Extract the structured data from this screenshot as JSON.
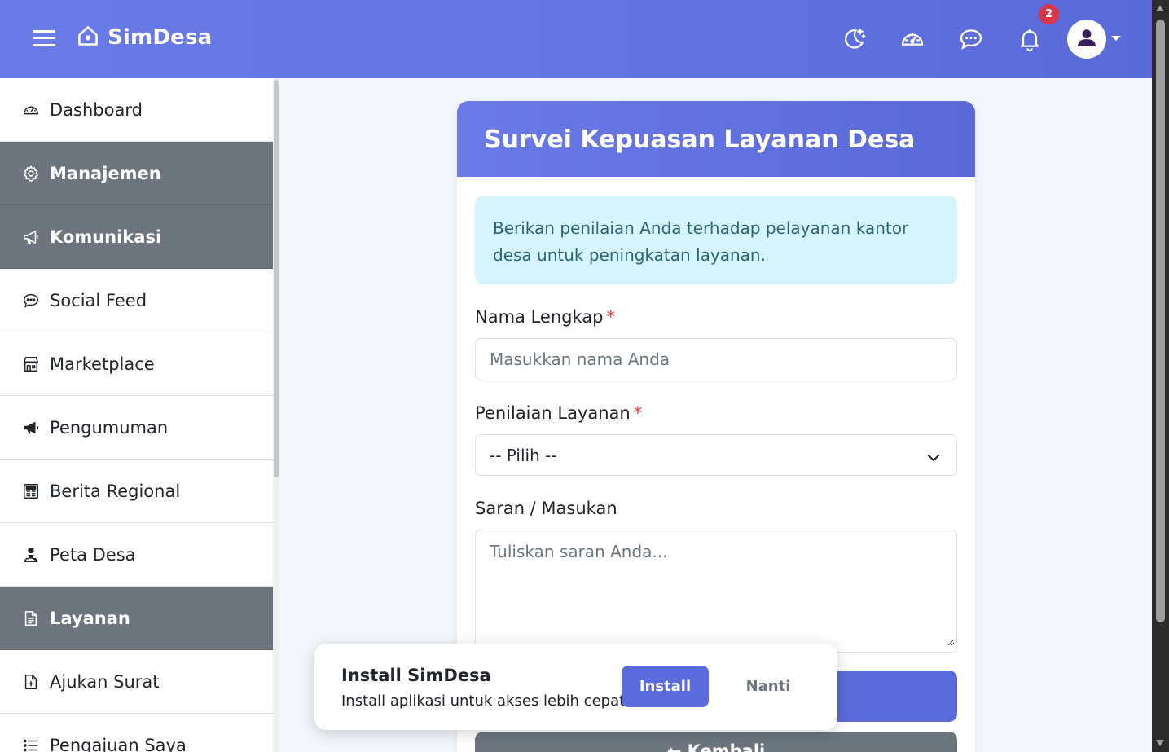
{
  "navbar": {
    "brand": "SimDesa",
    "brand_icon": "home-heart-icon",
    "icons": [
      "moon-stars-icon",
      "speedometer-icon",
      "chat-dots-icon",
      "bell-icon"
    ],
    "notification_count": "2",
    "avatar_icon": "person-icon"
  },
  "sidebar": {
    "items": [
      {
        "label": "Dashboard",
        "icon": "speedometer-icon",
        "section": false
      },
      {
        "label": "Manajemen",
        "icon": "gear-icon",
        "section": true
      },
      {
        "label": "Komunikasi",
        "icon": "megaphone-icon",
        "section": true
      },
      {
        "label": "Social Feed",
        "icon": "chat-dots-icon",
        "section": false
      },
      {
        "label": "Marketplace",
        "icon": "shop-icon",
        "section": false
      },
      {
        "label": "Pengumuman",
        "icon": "megaphone-fill-icon",
        "section": false
      },
      {
        "label": "Berita Regional",
        "icon": "newspaper-icon",
        "section": false
      },
      {
        "label": "Peta Desa",
        "icon": "person-pin-icon",
        "section": false
      },
      {
        "label": "Layanan",
        "icon": "file-text-icon",
        "section": true
      },
      {
        "label": "Ajukan Surat",
        "icon": "file-plus-icon",
        "section": false
      },
      {
        "label": "Pengajuan Saya",
        "icon": "list-icon",
        "section": false
      }
    ]
  },
  "card": {
    "title": "Survei Kepuasan Layanan Desa",
    "info": "Berikan penilaian Anda terhadap pelayanan kantor desa untuk peningkatan layanan.",
    "name_label": "Nama Lengkap",
    "required_mark": "*",
    "name_placeholder": "Masukkan nama Anda",
    "rating_label": "Penilaian Layanan",
    "rating_selected": "-- Pilih --",
    "suggestion_label": "Saran / Masukan",
    "suggestion_placeholder": "Tuliskan saran Anda...",
    "back_label": "← Kembali"
  },
  "install_popup": {
    "title": "Install SimDesa",
    "description": "Install aplikasi untuk akses lebih cepat",
    "install_label": "Install",
    "later_label": "Nanti"
  },
  "colors": {
    "primary": "#6477e4",
    "section_gray": "#6c757d",
    "alert_bg": "#d6f4fb",
    "danger": "#dc3545"
  }
}
